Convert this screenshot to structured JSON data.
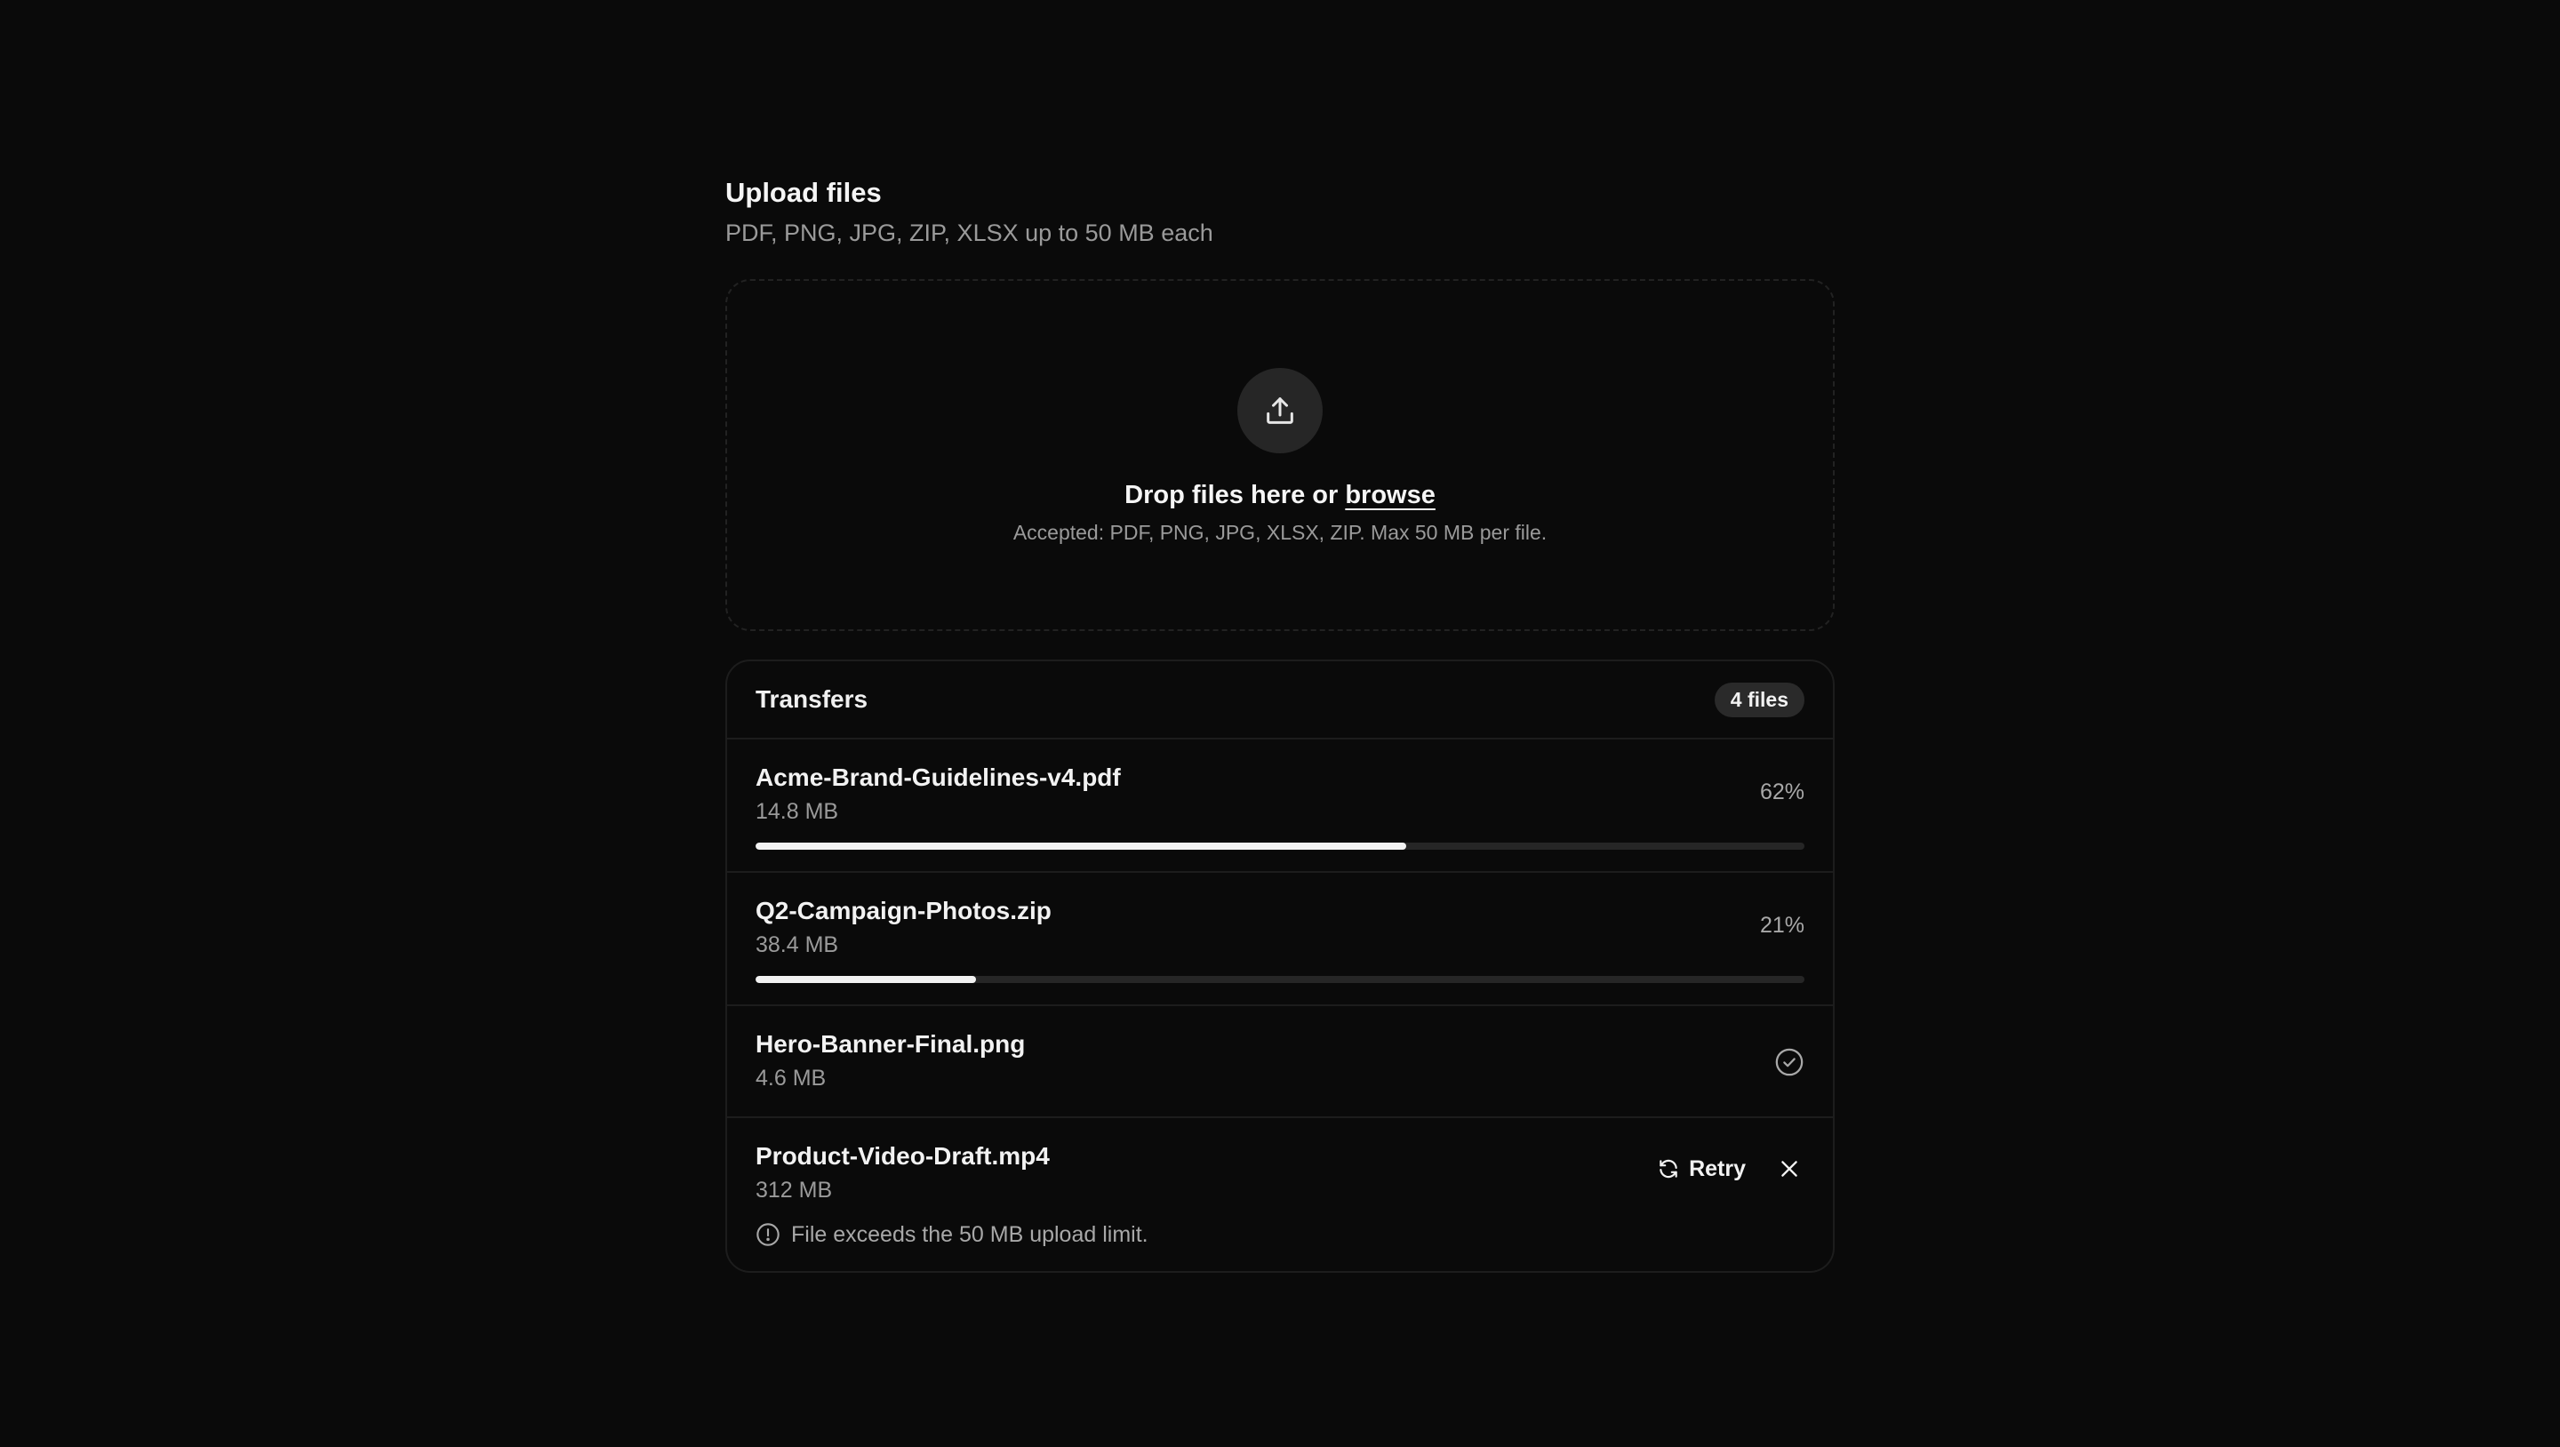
{
  "header": {
    "title": "Upload files",
    "subtitle": "PDF, PNG, JPG, ZIP, XLSX up to 50 MB each"
  },
  "dropzone": {
    "icon": "upload-icon",
    "prompt": "Drop files here or",
    "browse_label": "browse",
    "hint": "Accepted: PDF, PNG, JPG, XLSX, ZIP. Max 50 MB per file."
  },
  "transfers": {
    "title": "Transfers",
    "count_label": "4 files",
    "files": [
      {
        "name": "Acme-Brand-Guidelines-v4.pdf",
        "size": "14.8 MB",
        "status": "uploading",
        "progress_label": "62%",
        "progress": 0.62
      },
      {
        "name": "Q2-Campaign-Photos.zip",
        "size": "38.4 MB",
        "status": "uploading",
        "progress_label": "21%",
        "progress": 0.21
      },
      {
        "name": "Hero-Banner-Final.png",
        "size": "4.6 MB",
        "status": "complete",
        "icon": "check-circle-icon"
      },
      {
        "name": "Product-Video-Draft.mp4",
        "size": "312 MB",
        "status": "error",
        "retry_label": "Retry",
        "error_message": "File exceeds the 50 MB upload limit."
      }
    ]
  },
  "colors": {
    "background": "#0a0a0a",
    "progress_fill": "#f2f2f2",
    "progress_track": "#262626"
  }
}
